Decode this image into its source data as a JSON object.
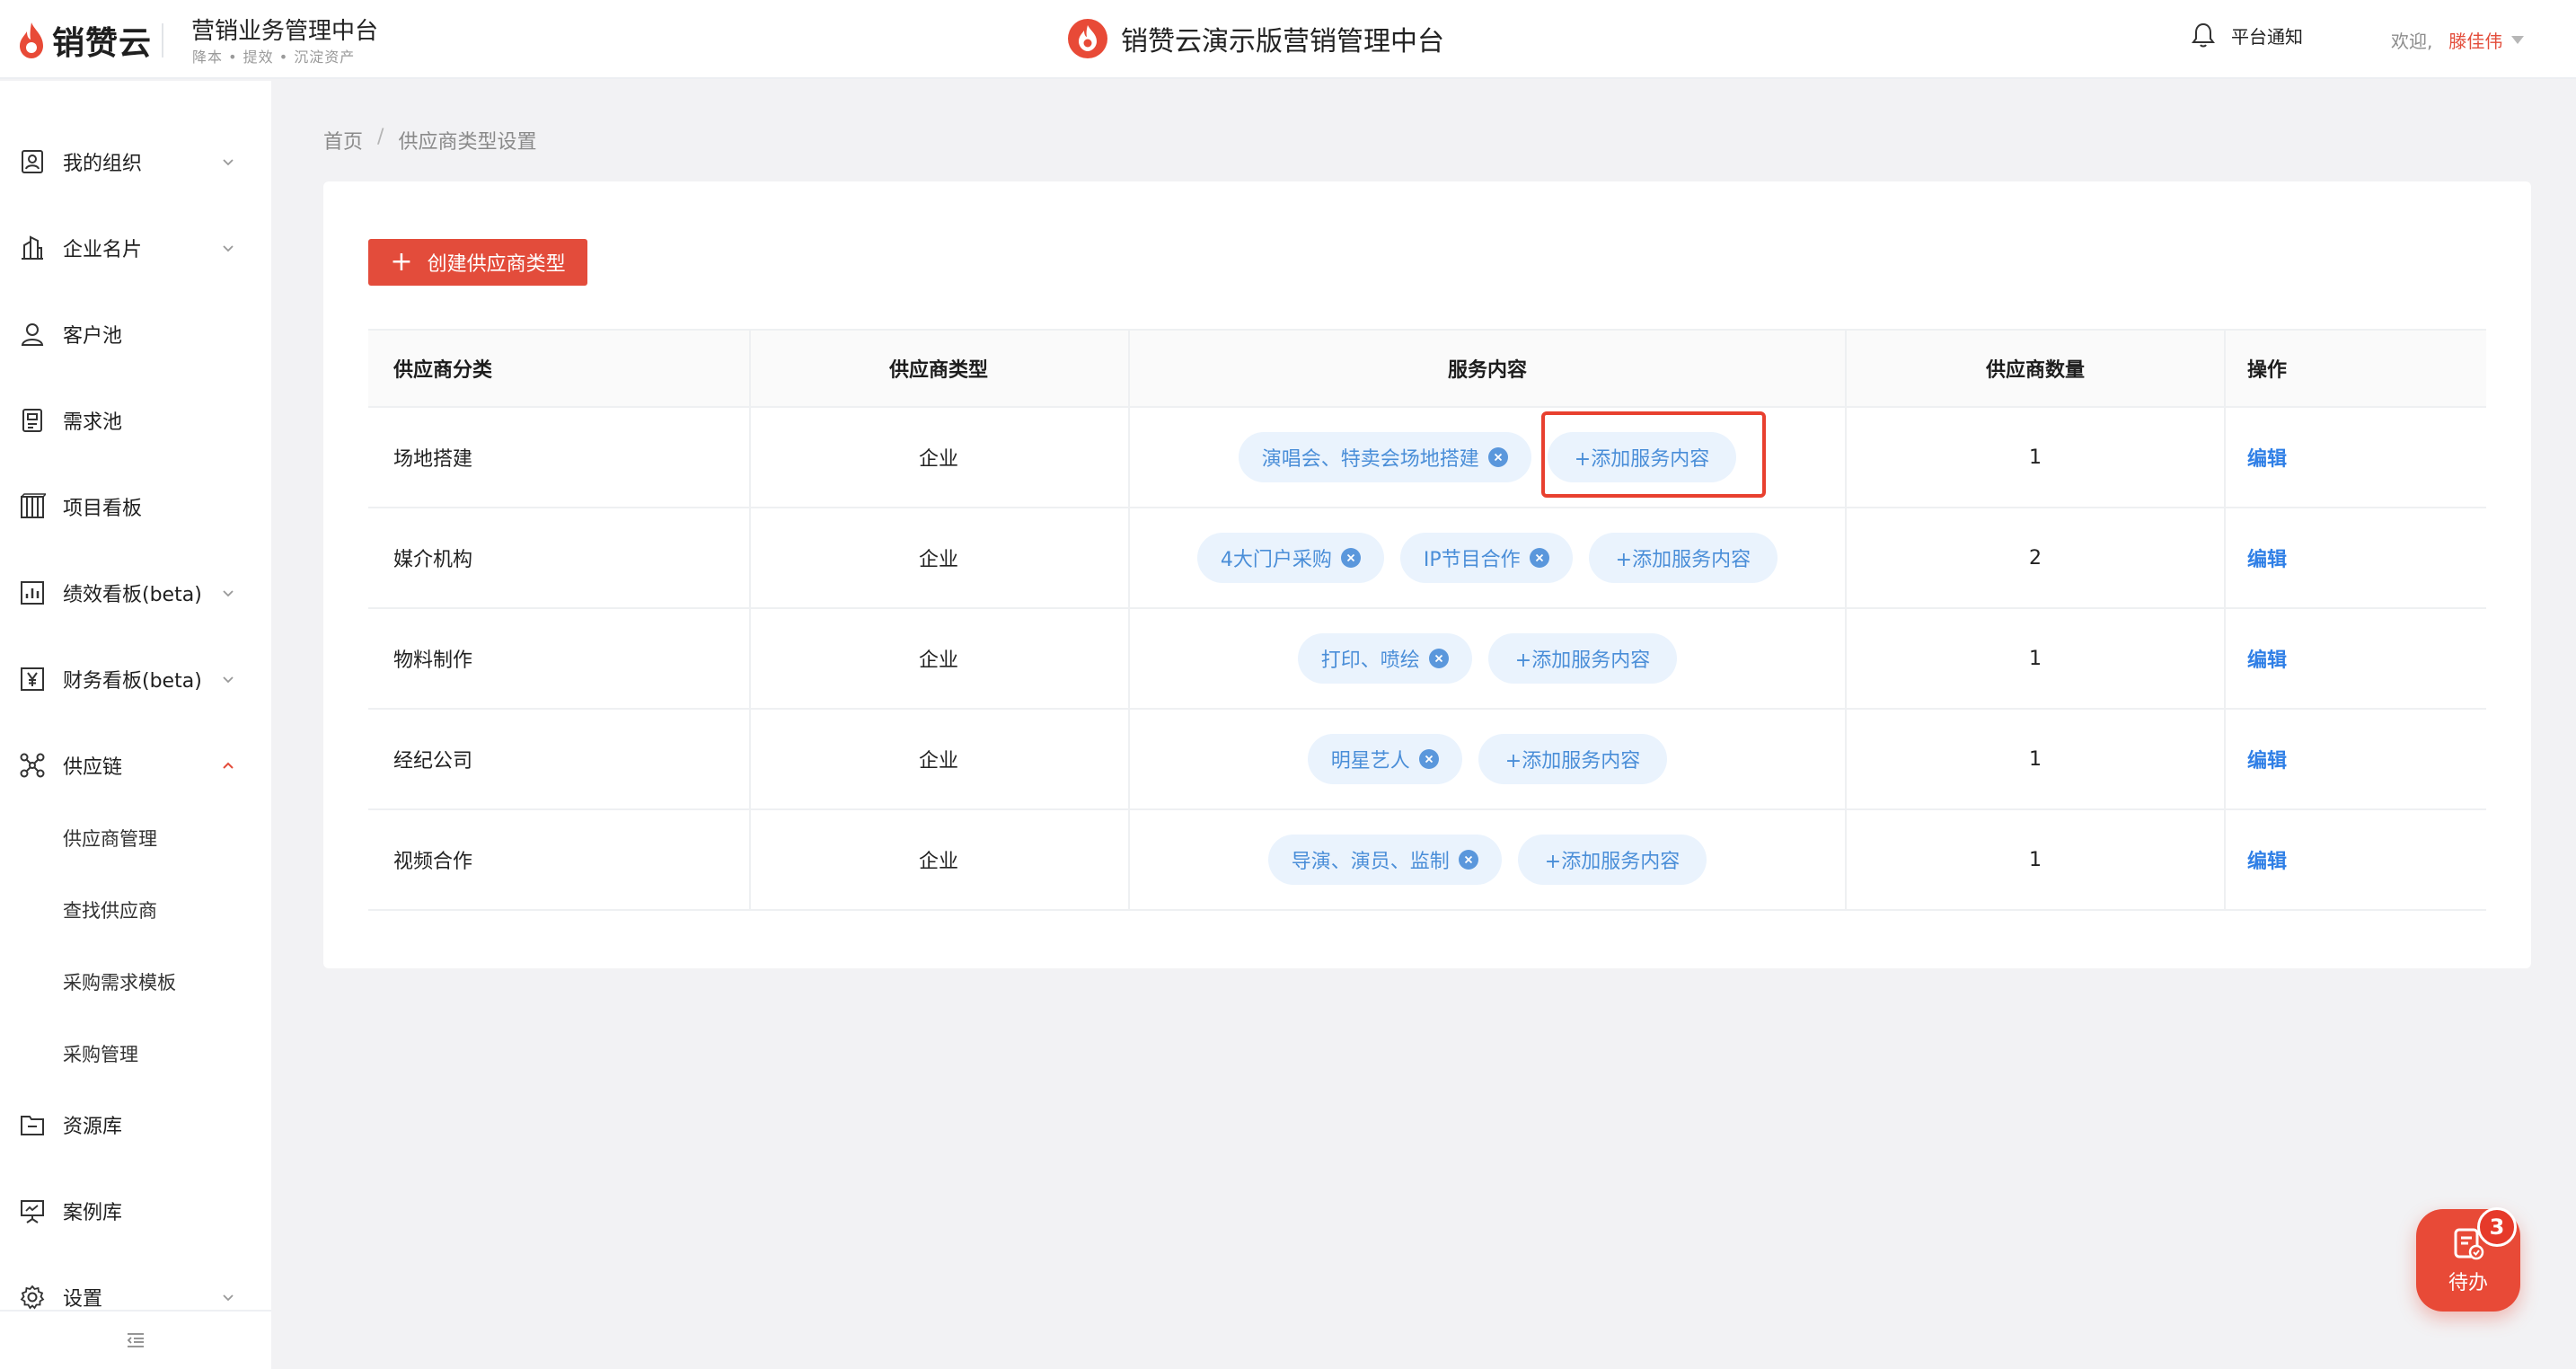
{
  "header": {
    "logo_text": "销赞云",
    "system_title": "营销业务管理中台",
    "system_subtitle": "降本 • 提效 • 沉淀资产",
    "brand_title": "销赞云演示版营销管理中台",
    "notice_label": "平台通知",
    "welcome_label": "欢迎,",
    "user_name": "滕佳伟"
  },
  "sidebar": {
    "items": [
      {
        "label": "我的组织",
        "icon": "org-icon",
        "chevron": "down"
      },
      {
        "label": "企业名片",
        "icon": "building-icon",
        "chevron": "down"
      },
      {
        "label": "客户池",
        "icon": "user-icon",
        "chevron": ""
      },
      {
        "label": "需求池",
        "icon": "document-icon",
        "chevron": ""
      },
      {
        "label": "项目看板",
        "icon": "board-icon",
        "chevron": ""
      },
      {
        "label": "绩效看板(beta)",
        "icon": "bar-chart-icon",
        "chevron": "down"
      },
      {
        "label": "财务看板(beta)",
        "icon": "yen-icon",
        "chevron": "down"
      },
      {
        "label": "供应链",
        "icon": "network-icon",
        "chevron": "up"
      },
      {
        "label": "资源库",
        "icon": "folder-icon",
        "chevron": ""
      },
      {
        "label": "案例库",
        "icon": "presentation-icon",
        "chevron": ""
      },
      {
        "label": "设置",
        "icon": "gear-icon",
        "chevron": "down"
      }
    ],
    "supply_chain_sub": [
      "供应商管理",
      "查找供应商",
      "采购需求模板",
      "采购管理"
    ]
  },
  "breadcrumb": {
    "home": "首页",
    "separator": "/",
    "current": "供应商类型设置"
  },
  "toolbar": {
    "create_label": "创建供应商类型"
  },
  "table": {
    "headers": [
      "供应商分类",
      "供应商类型",
      "服务内容",
      "供应商数量",
      "操作"
    ],
    "add_label": "+添加服务内容",
    "edit_label": "编辑",
    "rows": [
      {
        "category": "场地搭建",
        "type": "企业",
        "services": [
          "演唱会、特卖会场地搭建"
        ],
        "count": "1"
      },
      {
        "category": "媒介机构",
        "type": "企业",
        "services": [
          "4大门户采购",
          "IP节目合作"
        ],
        "count": "2"
      },
      {
        "category": "物料制作",
        "type": "企业",
        "services": [
          "打印、喷绘"
        ],
        "count": "1"
      },
      {
        "category": "经纪公司",
        "type": "企业",
        "services": [
          "明星艺人"
        ],
        "count": "1"
      },
      {
        "category": "视频合作",
        "type": "企业",
        "services": [
          "导演、演员、监制"
        ],
        "count": "1"
      }
    ]
  },
  "todo": {
    "label": "待办",
    "badge": "3"
  },
  "colors": {
    "brand_red": "#e34c3b",
    "tag_bg": "#eaf3fd",
    "tag_text": "#4a8ed8",
    "link_blue": "#2f7fe6"
  }
}
